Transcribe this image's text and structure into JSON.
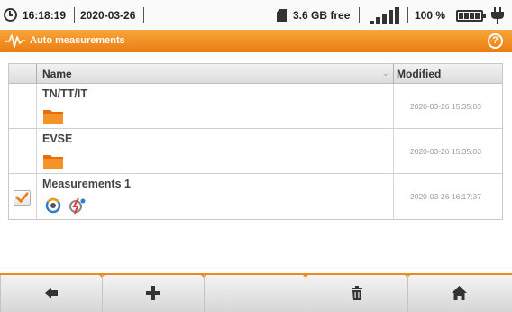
{
  "status_bar": {
    "time": "16:18:19",
    "date": "2020-03-26",
    "storage": "3.6 GB free",
    "battery": "100 %",
    "icons": [
      "clock-icon",
      "sd-card-icon",
      "signal-icon",
      "battery-icon",
      "plug-icon"
    ]
  },
  "title_bar": {
    "title": "Auto measurements",
    "help": "?",
    "accent": "#ec7d12"
  },
  "table": {
    "columns": {
      "name": "Name",
      "modified": "Modified"
    },
    "rows": [
      {
        "name": "TN/TT/IT",
        "modified": "2020-03-26 15:35:03",
        "icon": "folder-icon",
        "checked": false
      },
      {
        "name": "EVSE",
        "modified": "2020-03-26 15:35:03",
        "icon": "folder-icon",
        "checked": false
      },
      {
        "name": "Measurements 1",
        "modified": "2020-03-26 16:17:37",
        "icon": "measurement-icons",
        "checked": true
      }
    ]
  },
  "toolbar": {
    "buttons": [
      "back-icon",
      "add-icon",
      "empty",
      "delete-icon",
      "home-icon"
    ]
  }
}
